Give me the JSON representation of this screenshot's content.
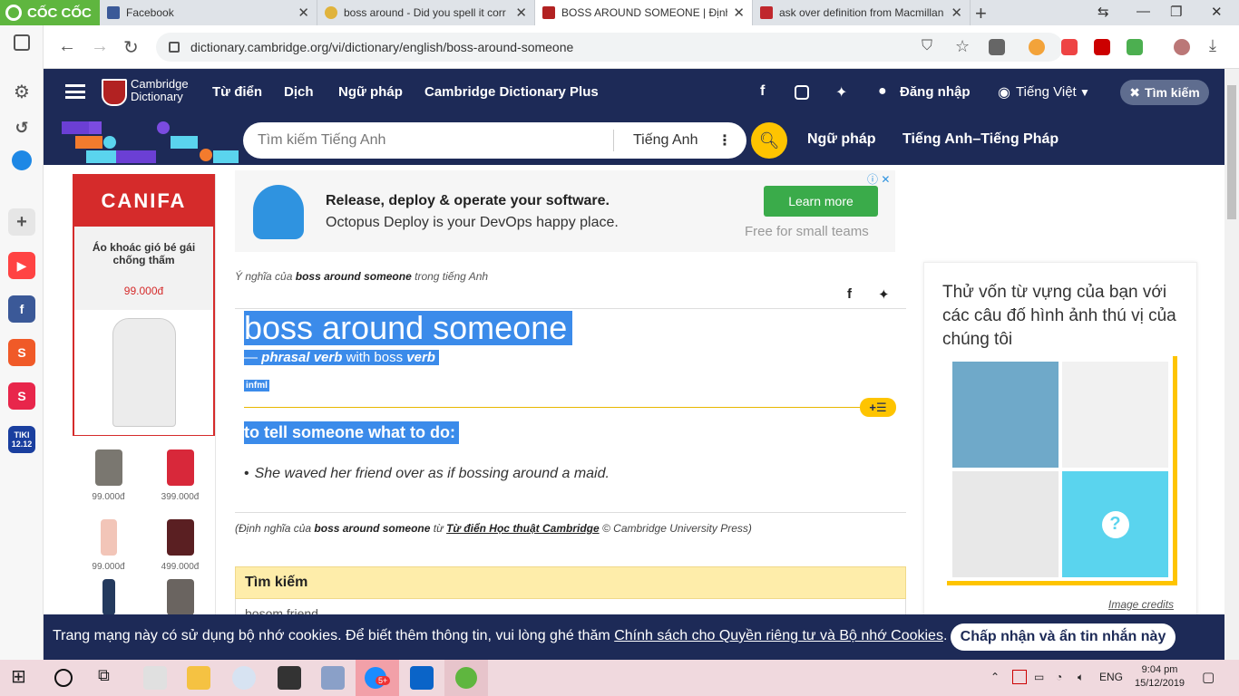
{
  "browser": {
    "brand": "CỐC CỐC",
    "tabs": [
      {
        "title": "Facebook"
      },
      {
        "title": "boss around - Did you spell it corr"
      },
      {
        "title": "BOSS AROUND SOMEONE | Định n"
      },
      {
        "title": "ask over definition from Macmillan"
      }
    ],
    "url": "dictionary.cambridge.org/vi/dictionary/english/boss-around-someone"
  },
  "header": {
    "logo_line1": "Cambridge",
    "logo_line2": "Dictionary",
    "nav": [
      "Từ điển",
      "Dịch",
      "Ngữ pháp",
      "Cambridge Dictionary Plus"
    ],
    "login": "Đăng nhập",
    "language": "Tiếng Việt",
    "search_pill": "Tìm kiếm"
  },
  "searchbar": {
    "placeholder": "Tìm kiếm Tiếng Anh",
    "lang": "Tiếng Anh",
    "link1": "Ngữ pháp",
    "link2": "Tiếng Anh–Tiếng Pháp"
  },
  "left_ad": {
    "brand": "CANIFA",
    "name": "Áo khoác gió bé gái chống thấm",
    "price": "99.000đ",
    "products": [
      {
        "price": "99.000đ",
        "color": "#7a7770"
      },
      {
        "price": "399.000đ",
        "color": "#d8283a"
      },
      {
        "price": "99.000đ",
        "color": "#f2c5b8"
      },
      {
        "price": "499.000đ",
        "color": "#5a1f22"
      },
      {
        "price": "",
        "color": "#243a5e"
      },
      {
        "price": "",
        "color": "#6a6460"
      }
    ]
  },
  "top_ad": {
    "title": "Release, deploy & operate your software.",
    "subtitle": "Octopus Deploy is your DevOps happy place.",
    "button": "Learn more",
    "note": "Free for small teams"
  },
  "entry": {
    "meaning_prefix": "Ý nghĩa của",
    "meaning_word": "boss around someone",
    "meaning_suffix": "trong tiếng Anh",
    "headword": "boss around someone",
    "pos_dash": "—",
    "pos_label": "phrasal verb",
    "pos_with": "with boss",
    "pos_verb": "verb",
    "register": "infml",
    "definition": "to tell someone what to do:",
    "example": "She waved her friend over as if bossing around a maid.",
    "source_prefix": "(Định nghĩa của",
    "source_word": "boss around someone",
    "source_from": "từ",
    "source_dict": "Từ điển Học thuật Cambridge",
    "source_suffix": "© Cambridge University Press)"
  },
  "search_section": {
    "title": "Tìm kiếm",
    "first_item": "bosom friend"
  },
  "quiz": {
    "title": "Thử vốn từ vựng của bạn với các câu đố hình ảnh thú vị của chúng tôi",
    "credits": "Image credits"
  },
  "cookie": {
    "text": "Trang mạng này có sử dụng bộ nhớ cookies. Để biết thêm thông tin, vui lòng ghé thăm",
    "link": "Chính sách cho Quyền riêng tư và Bộ nhớ Cookies",
    "button": "Chấp nhận và ẩn tin nhắn này"
  },
  "taskbar": {
    "lang": "ENG",
    "time": "9:04 pm",
    "date": "15/12/2019",
    "zalo_badge": "5+"
  },
  "sidebar": {
    "tiki_line1": "TIKI",
    "tiki_line2": "12.12"
  }
}
